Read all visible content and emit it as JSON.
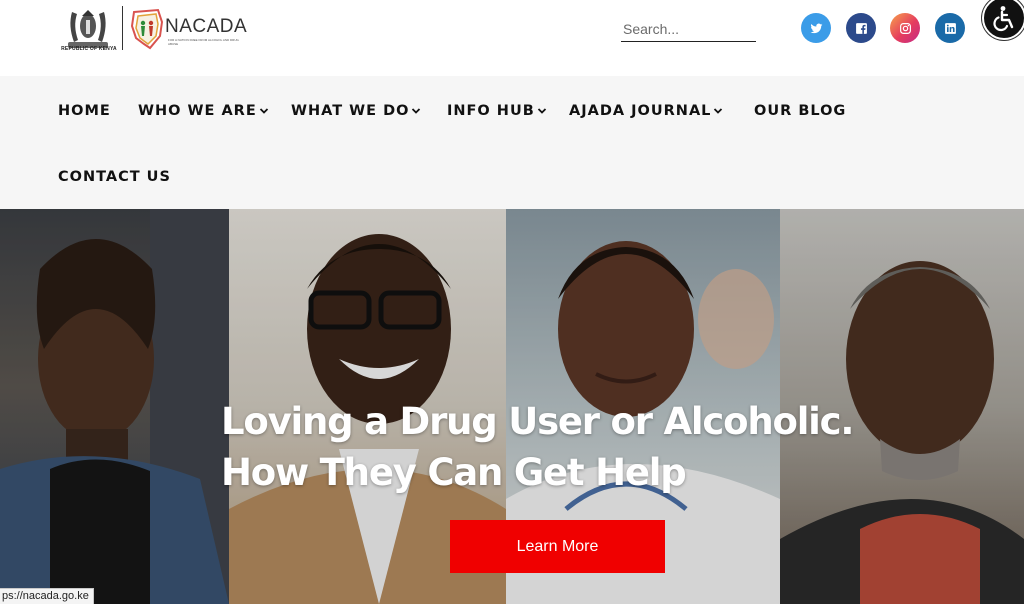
{
  "header": {
    "coat_caption": "REPUBLIC OF KENYA",
    "logo_text": "NACADA",
    "logo_tagline": "FOR A NATION FREE FROM ALCOHOL AND DRUG ABUSE",
    "search_placeholder": "Search...",
    "social": [
      {
        "name": "twitter",
        "color": "#3b9ce8"
      },
      {
        "name": "facebook",
        "color": "#2c4a8b"
      },
      {
        "name": "instagram",
        "color": "#e53d5e"
      },
      {
        "name": "linkedin",
        "color": "#1a6aa8"
      }
    ]
  },
  "nav": {
    "items": [
      {
        "label": "HOME",
        "dropdown": false
      },
      {
        "label": "WHO WE ARE",
        "dropdown": true
      },
      {
        "label": "WHAT WE DO",
        "dropdown": true
      },
      {
        "label": "INFO HUB",
        "dropdown": true
      },
      {
        "label": "AJADA JOURNAL",
        "dropdown": true
      },
      {
        "label": "OUR BLOG",
        "dropdown": false
      },
      {
        "label": "CONTACT US",
        "dropdown": false
      }
    ]
  },
  "hero": {
    "title_line1": "Loving a Drug User or Alcoholic.",
    "title_line2": "How They Can Get Help",
    "cta_label": "Learn More",
    "cta_color": "#f00000"
  },
  "status_bar": {
    "url": "ps://nacada.go.ke"
  }
}
